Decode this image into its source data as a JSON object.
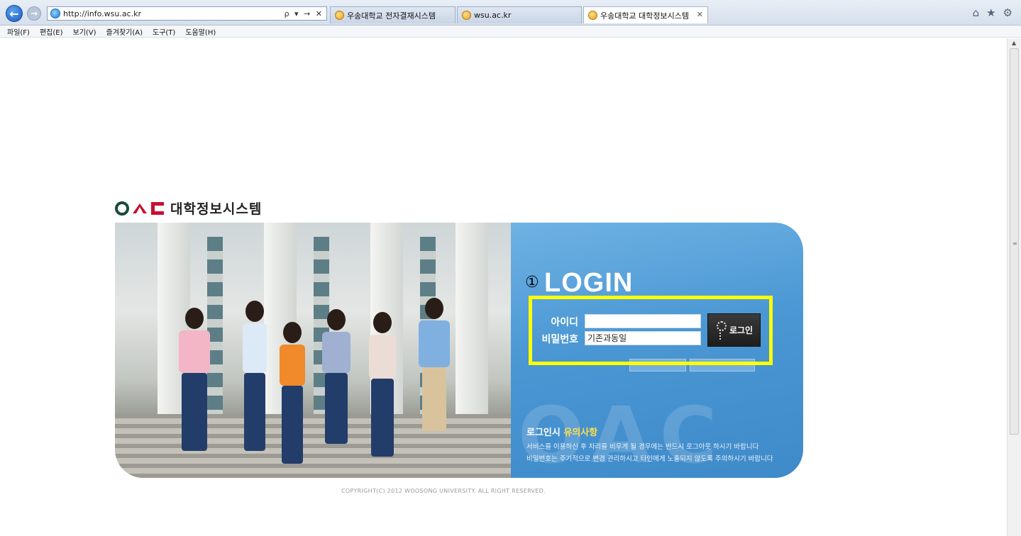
{
  "browser": {
    "address_url": "http://info.wsu.ac.kr",
    "address_tools": "ρ ▾ → ✕",
    "tabs": [
      {
        "label": "우송대학교 전자결재시스템"
      },
      {
        "label": "wsu.ac.kr"
      },
      {
        "label": "우송대학교 대학정보시스템"
      }
    ],
    "tab_close": "✕",
    "right_icons": {
      "home": "⌂",
      "favorites": "★",
      "tools": "⚙"
    },
    "menu": [
      "파일(F)",
      "편집(E)",
      "보기(V)",
      "즐겨찾기(A)",
      "도구(T)",
      "도움말(H)"
    ]
  },
  "page": {
    "logo_text": "대학정보시스템",
    "login": {
      "marker": "①",
      "title": "LOGIN",
      "id_label": "아이디",
      "id_value": "",
      "pw_label": "비밀번호",
      "pw_value": "기존과동일",
      "login_button": "로그인"
    },
    "notice": {
      "title_prefix": "로그인시 ",
      "title_highlight": "유의사항",
      "lines": [
        "서비스를 이용하신 후 자리를 비우게 될 경우에는 반드시 로그아웃 하시기 바랍니다",
        "비밀번호는 주기적으로 변경 관리하시고 타인에게 노출되지 않도록 주의하시기 바랍니다"
      ]
    },
    "watermark": "OAC",
    "copyright": "COPYRIGHT(C) 2012 WOOSONG UNIVERSITY.  ALL RIGHT RESERVED."
  },
  "colors": {
    "highlight": "#ffff00",
    "panel_blue": "#4a97d4",
    "brand_green": "#1a4a3c",
    "brand_red": "#c8102e"
  }
}
